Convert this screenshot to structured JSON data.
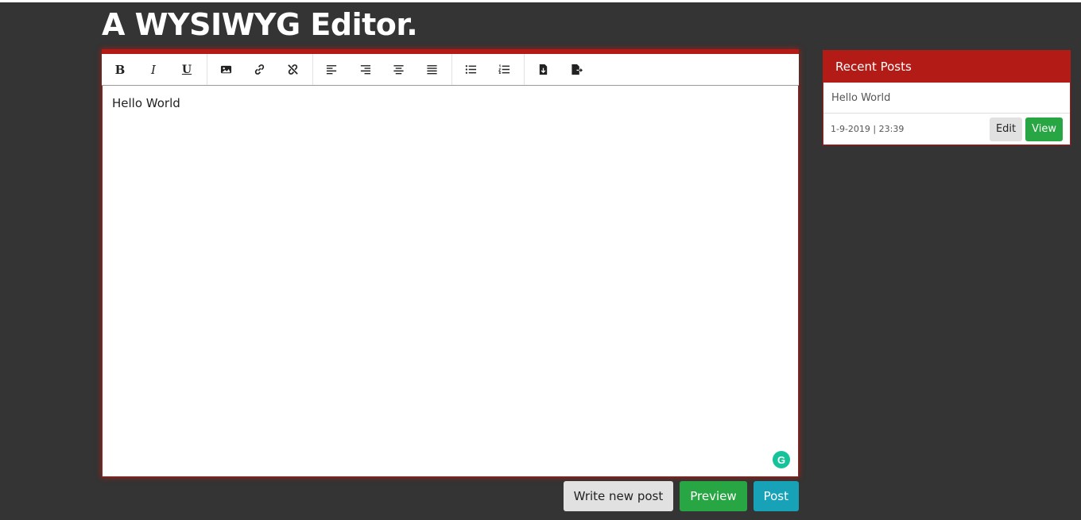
{
  "page": {
    "title": "A WYSIWYG Editor."
  },
  "toolbar": {
    "groups": [
      [
        {
          "name": "bold-icon",
          "glyph": "B"
        },
        {
          "name": "italic-icon",
          "glyph": "I"
        },
        {
          "name": "underline-icon",
          "glyph": "U"
        }
      ],
      [
        {
          "name": "image-icon"
        },
        {
          "name": "link-icon"
        },
        {
          "name": "unlink-icon"
        }
      ],
      [
        {
          "name": "align-left-icon"
        },
        {
          "name": "align-right-icon"
        },
        {
          "name": "align-center-icon"
        },
        {
          "name": "align-justify-icon"
        }
      ],
      [
        {
          "name": "bullet-list-icon"
        },
        {
          "name": "numbered-list-icon"
        }
      ],
      [
        {
          "name": "file-import-icon"
        },
        {
          "name": "file-export-icon"
        }
      ]
    ],
    "accent_color": "#b31b17"
  },
  "editor": {
    "content": "Hello World"
  },
  "actions": {
    "write_new_post": "Write new post",
    "preview": "Preview",
    "post": "Post"
  },
  "recent_posts": {
    "header": "Recent Posts",
    "items": [
      {
        "title": "Hello World",
        "date": "1-9-2019 | 23:39",
        "edit_label": "Edit",
        "view_label": "View"
      }
    ]
  },
  "colors": {
    "background": "#343434",
    "accent": "#b31b17",
    "success": "#27a643",
    "info": "#17a2b8"
  }
}
